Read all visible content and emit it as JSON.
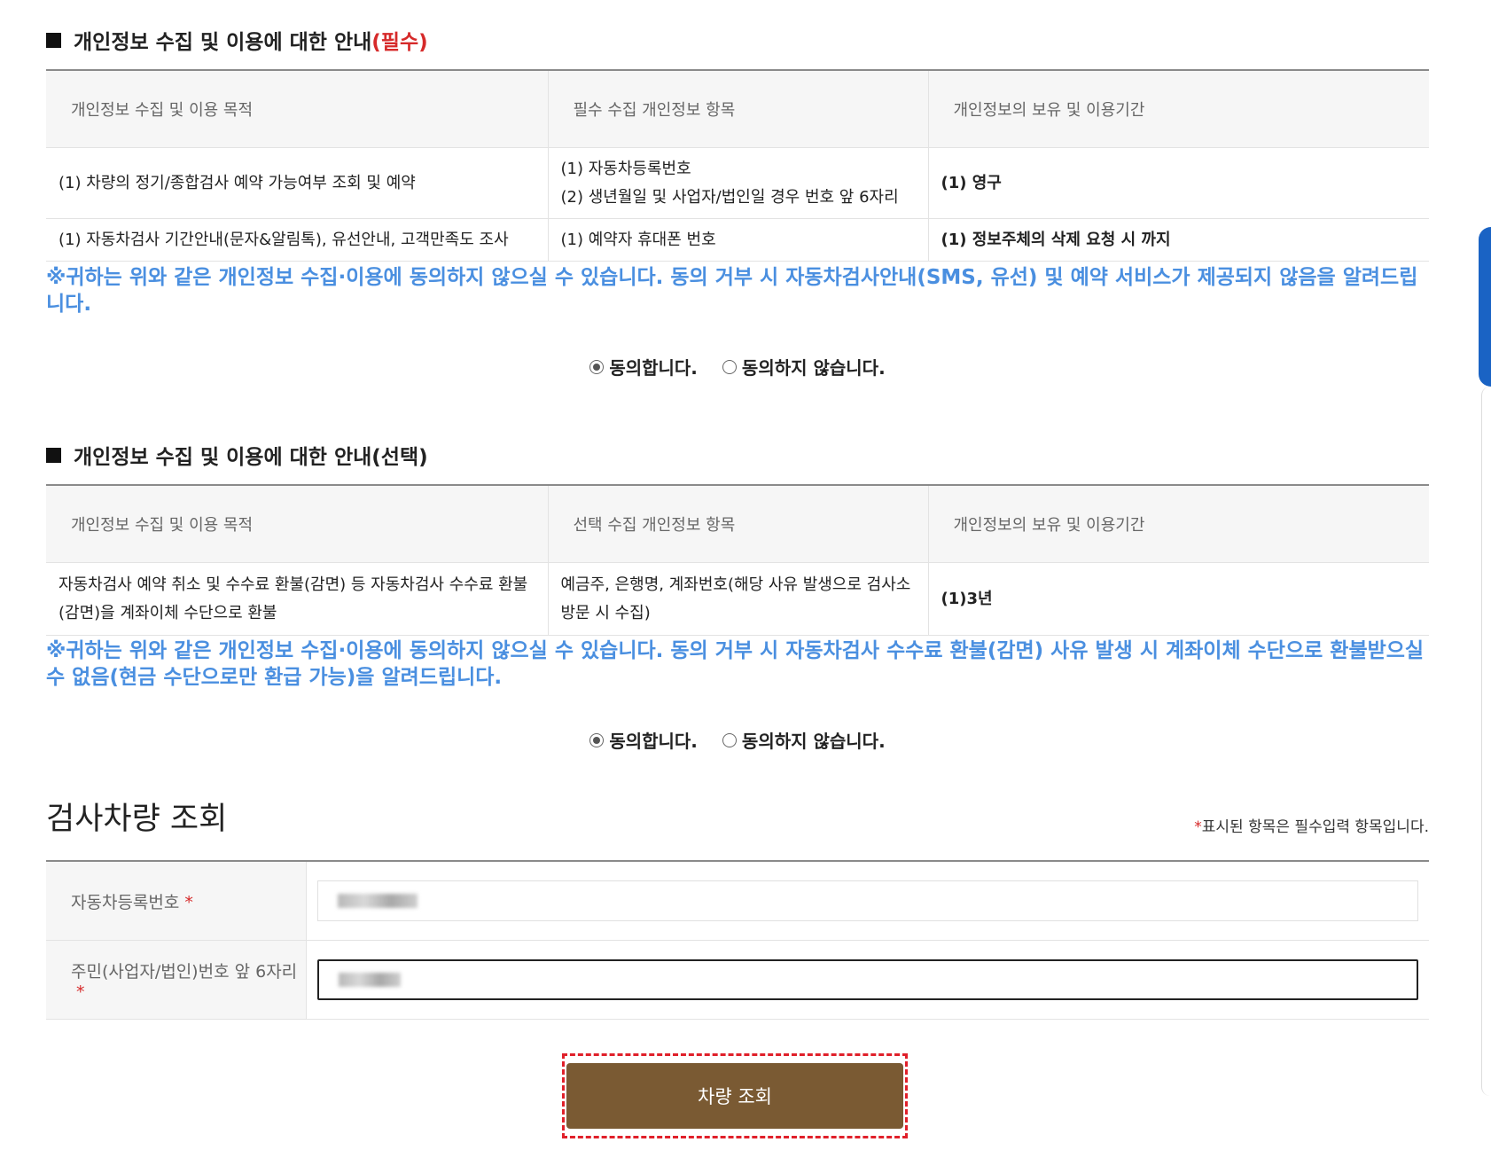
{
  "section1": {
    "title": "개인정보 수집 및 이용에 대한 안내",
    "required_tag": "(필수)",
    "headers": [
      "개인정보 수집 및 이용 목적",
      "필수 수집 개인정보 항목",
      "개인정보의 보유 및 이용기간"
    ],
    "rows": [
      {
        "purpose": "(1) 차량의 정기/종합검사 예약 가능여부 조회 및 예약",
        "items": [
          "(1) 자동차등록번호",
          "(2) 생년월일 및 사업자/법인일 경우 번호 앞 6자리"
        ],
        "period": "(1) 영구"
      },
      {
        "purpose": "(1) 자동차검사 기간안내(문자&알림톡), 유선안내, 고객만족도 조사",
        "items": [
          "(1) 예약자 휴대폰 번호"
        ],
        "period": "(1) 정보주체의 삭제 요청 시 까지"
      }
    ],
    "notice": "※귀하는 위와 같은 개인정보 수집·이용에 동의하지 않으실 수 있습니다. 동의 거부 시 자동차검사안내(SMS, 유선) 및 예약 서비스가 제공되지 않음을 알려드립니다.",
    "agree_label": "동의합니다.",
    "disagree_label": "동의하지 않습니다."
  },
  "section2": {
    "title": "개인정보 수집 및 이용에 대한 안내(선택)",
    "headers": [
      "개인정보 수집 및 이용 목적",
      "선택 수집 개인정보 항목",
      "개인정보의 보유 및 이용기간"
    ],
    "rows": [
      {
        "purpose": "자동차검사 예약 취소 및 수수료 환불(감면) 등 자동차검사 수수료 환불(감면)을 계좌이체 수단으로 환불",
        "items": [
          "예금주, 은행명, 계좌번호(해당 사유 발생으로 검사소 방문 시 수집)"
        ],
        "period": "(1)3년"
      }
    ],
    "notice": "※귀하는 위와 같은 개인정보 수집·이용에 동의하지 않으실 수 있습니다. 동의 거부 시 자동차검사 수수료 환불(감면) 사유 발생 시 계좌이체 수단으로 환불받으실 수 없음(현금 수단으로만 환급 가능)을 알려드립니다.",
    "agree_label": "동의합니다.",
    "disagree_label": "동의하지 않습니다."
  },
  "search": {
    "title": "검사차량 조회",
    "required_note_star": "*",
    "required_note": "표시된 항목은 필수입력 항목입니다.",
    "fields": [
      {
        "label": "자동차등록번호",
        "star": "*"
      },
      {
        "label": "주민(사업자/법인)번호 앞 6자리",
        "star": "*"
      }
    ],
    "button_label": "차량 조회"
  },
  "colors": {
    "accent_blue": "#4a8fe0",
    "required_red": "#d62a2a",
    "button_brown": "#7a5a33"
  }
}
